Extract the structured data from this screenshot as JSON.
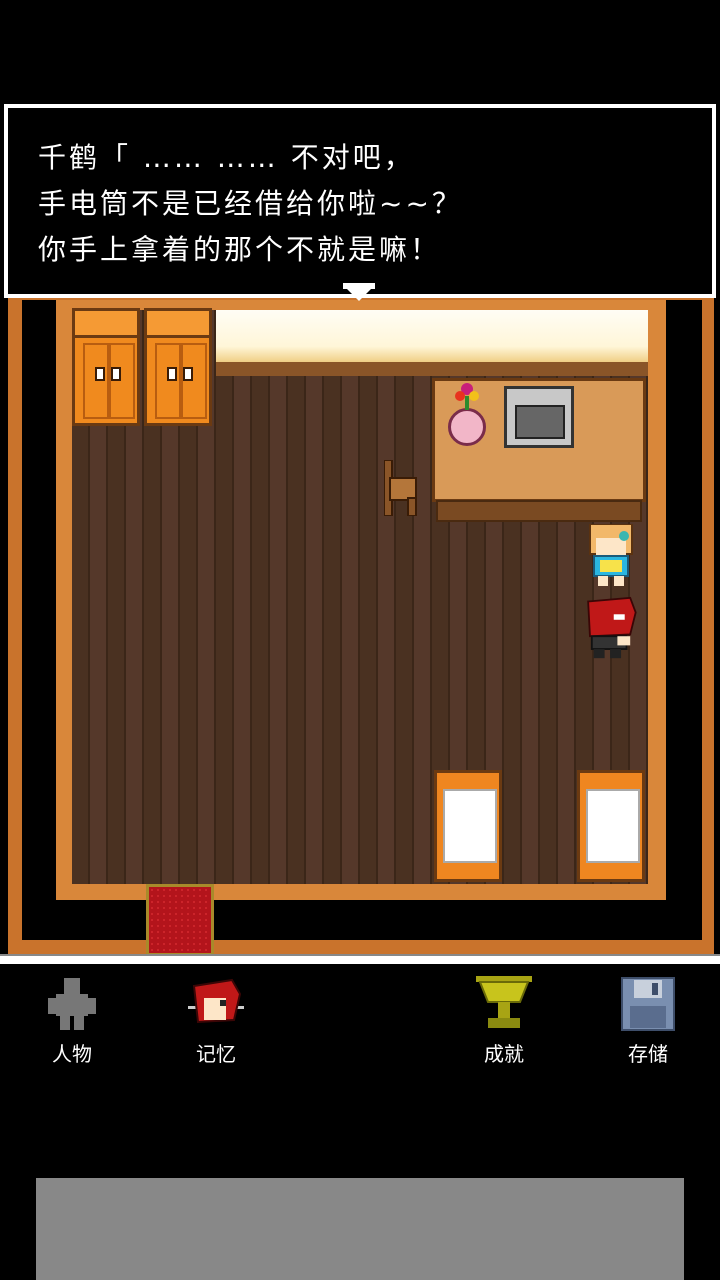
{
  "dialogue": {
    "lines": [
      "千鹤「 …… …… 不对吧，",
      " 手电筒不是已经借给你啦~~？",
      " 你手上拿着的那个不就是嘛！"
    ]
  },
  "menu": {
    "items": [
      {
        "label": "人物",
        "icon": "person-icon"
      },
      {
        "label": "记忆",
        "icon": "memory-icon"
      },
      {
        "label": "成就",
        "icon": "trophy-icon"
      },
      {
        "label": "存储",
        "icon": "save-icon"
      }
    ]
  },
  "colors": {
    "wall": "#c9732c",
    "floor": "#4a3121",
    "dialogue_bg": "#000000",
    "dialogue_text": "#ffffff",
    "ad_panel": "#888888"
  }
}
